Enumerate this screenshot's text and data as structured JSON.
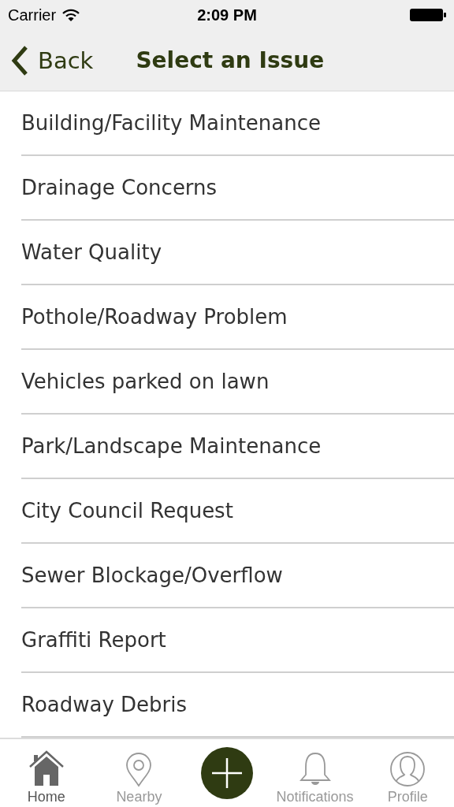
{
  "status_bar": {
    "carrier": "Carrier",
    "time": "2:09 PM"
  },
  "nav_bar": {
    "back": "Back",
    "title": "Select an Issue"
  },
  "issues": [
    {
      "label": "Building/Facility Maintenance"
    },
    {
      "label": "Drainage Concerns"
    },
    {
      "label": "Water Quality"
    },
    {
      "label": "Pothole/Roadway Problem"
    },
    {
      "label": "Vehicles parked on lawn"
    },
    {
      "label": "Park/Landscape Maintenance"
    },
    {
      "label": "City Council Request"
    },
    {
      "label": "Sewer Blockage/Overflow"
    },
    {
      "label": "Graffiti Report"
    },
    {
      "label": "Roadway Debris"
    }
  ],
  "tab_bar": [
    {
      "kind": "home",
      "label": "Home",
      "selected": true
    },
    {
      "kind": "nearby",
      "label": "Nearby",
      "selected": false
    },
    {
      "kind": "add",
      "selected": false
    },
    {
      "kind": "notifications",
      "label": "Notifications",
      "selected": false
    },
    {
      "kind": "profile",
      "label": "Profile",
      "selected": false
    }
  ]
}
